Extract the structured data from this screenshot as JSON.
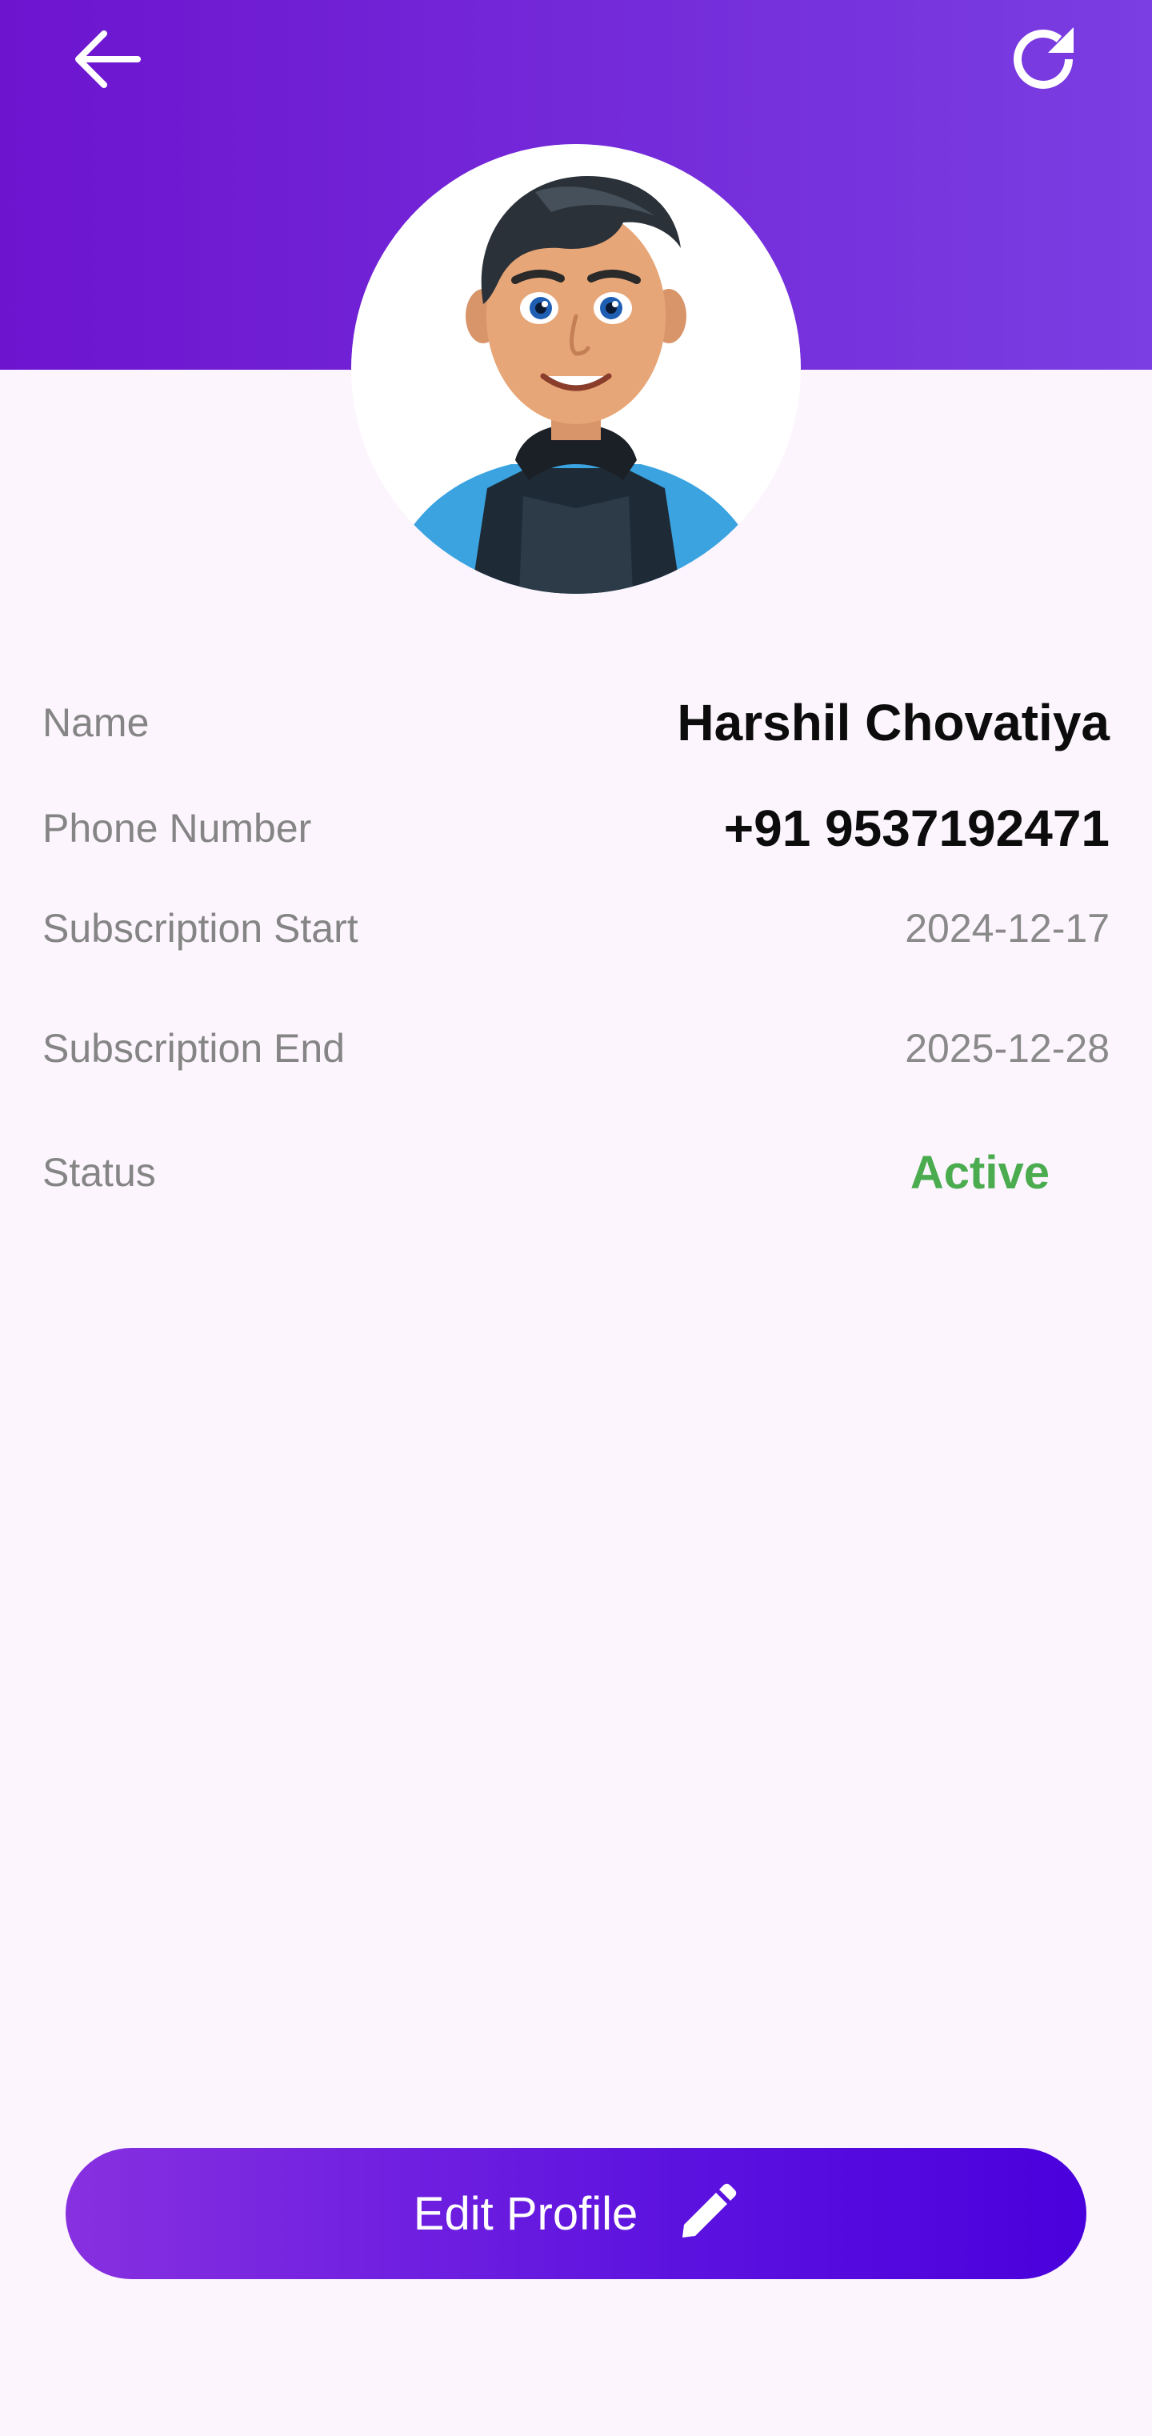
{
  "header": {
    "back_icon": "arrow-left-icon",
    "refresh_icon": "refresh-icon",
    "background_start": "#6d14cf",
    "background_end": "#7a3ee2"
  },
  "profile": {
    "avatar_icon": "cartoon-boy-avatar",
    "fields": {
      "name": {
        "label": "Name",
        "value": "Harshil Chovatiya"
      },
      "phone": {
        "label": "Phone Number",
        "value": "+91 9537192471"
      },
      "subscription_start": {
        "label": "Subscription Start",
        "value": "2024-12-17"
      },
      "subscription_end": {
        "label": "Subscription End",
        "value": "2025-12-28"
      },
      "status": {
        "label": "Status",
        "value": "Active",
        "color": "#4aac4f"
      }
    }
  },
  "actions": {
    "edit_profile_label": "Edit Profile",
    "edit_icon": "pencil-icon"
  }
}
